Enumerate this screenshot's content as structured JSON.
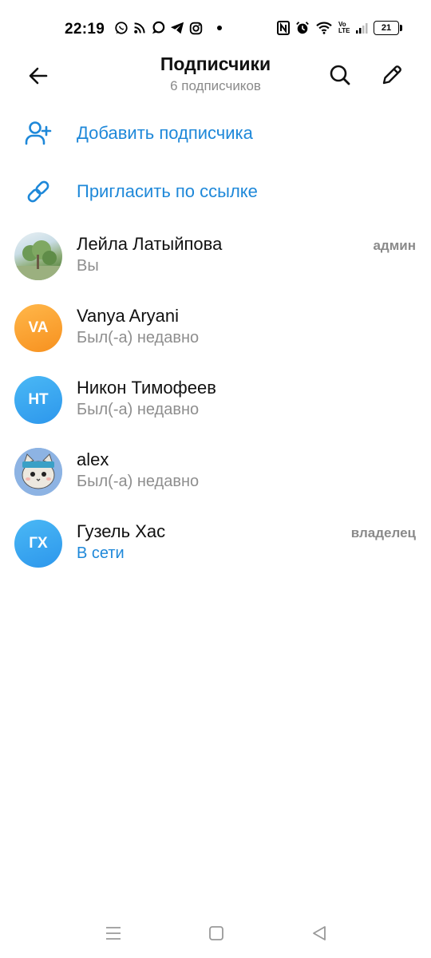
{
  "status_bar": {
    "time": "22:19",
    "battery": "21",
    "network": "Vo LTE"
  },
  "header": {
    "title": "Подписчики",
    "subtitle": "6 подписчиков"
  },
  "actions": [
    {
      "label": "Добавить подписчика",
      "icon": "add-user-icon"
    },
    {
      "label": "Пригласить по ссылке",
      "icon": "link-icon"
    }
  ],
  "members": [
    {
      "name": "Лейла Латыйпова",
      "status": "Вы",
      "role": "админ",
      "avatar": "photo-landscape",
      "online": false
    },
    {
      "name": "Vanya Aryani",
      "status": "Был(-а) недавно",
      "role": "",
      "initials": "VA",
      "avatar_color": "#f79a26",
      "online": false
    },
    {
      "name": "Никон Тимофеев",
      "status": "Был(-а) недавно",
      "role": "",
      "initials": "НТ",
      "avatar_color": "#2f9ff0",
      "online": false
    },
    {
      "name": "alex",
      "status": "Был(-а) недавно",
      "role": "",
      "avatar": "photo-cat",
      "online": false
    },
    {
      "name": "Гузель Хас",
      "status": "В сети",
      "role": "владелец",
      "initials": "ГХ",
      "avatar_color": "#2f9ff0",
      "online": true
    }
  ],
  "colors": {
    "accent": "#1e88d9",
    "secondary_text": "#8e8e8e"
  }
}
